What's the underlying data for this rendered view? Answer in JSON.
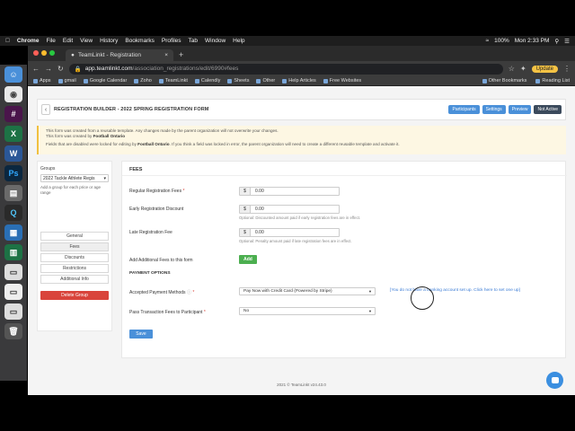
{
  "menubar": {
    "apple": "",
    "items": [
      "Chrome",
      "File",
      "Edit",
      "View",
      "History",
      "Bookmarks",
      "Profiles",
      "Tab",
      "Window",
      "Help"
    ],
    "battery": "100%",
    "clock": "Mon 2:33 PM"
  },
  "browser": {
    "tab_title": "TeamLinkt - Registration",
    "url_host": "app.teamlinkt.com",
    "url_path": "/association_registrations/edit/6990#fees",
    "update_label": "Update",
    "bookmarks": [
      "Apps",
      "gmail",
      "Google Calendar",
      "Zoho",
      "TeamLinkt",
      "Calendly",
      "Sheets",
      "Other",
      "Help Articles",
      "Free Websites"
    ],
    "bookmarks_right": [
      "Other Bookmarks",
      "Reading List"
    ]
  },
  "header": {
    "back_label": "‹",
    "title": "REGISTRATION BUILDER - 2022 SPRING REGISTRATION FORM",
    "buttons": [
      "Participants",
      "Settings",
      "Preview",
      "Not Active"
    ]
  },
  "notice": {
    "line1": "This form was created from a reusable template. Any changes made by the parent organization will not overwrite your changes.",
    "line2_prefix": "This form was created by ",
    "line2_org": "Football Ontario",
    "line3_prefix": "Fields that are disabled were locked for editing by ",
    "line3_org": "Football Ontario",
    "line3_suffix": ". If you think a field was locked in error, the parent organization will need to create a different reusable template and activate it."
  },
  "sidebar": {
    "groups_label": "Groups",
    "group_selected": "2022 Tackle Athlete Regis",
    "group_help": "Add a group for each price or age range",
    "nav": [
      "General",
      "Fees",
      "Discounts",
      "Restrictions",
      "Additional Info"
    ],
    "active": "Fees",
    "delete_label": "Delete Group"
  },
  "fees": {
    "heading": "FEES",
    "regular_label": "Regular Registration Fees",
    "required_mark": "*",
    "currency": "$",
    "regular_value": "0.00",
    "early_label": "Early Registration Discount",
    "early_value": "0.00",
    "early_help": "Optional: Discounted amount paid if early registration fees are in effect.",
    "late_label": "Late Registration Fee",
    "late_value": "0.00",
    "late_help": "Optional: Penalty amount paid if late registration fees are in effect.",
    "additional_label": "Add Additional Fees to this form",
    "add_label": "Add",
    "payment_heading": "PAYMENT OPTIONS",
    "accepted_label": "Accepted Payment Methods",
    "accepted_value": "Pay Now with Credit Card (Powered by Stripe)",
    "account_link": "[You do not have a banking account set up. Click here to set one up]",
    "pass_label": "Pass Transaction Fees to Participant",
    "pass_value": "No",
    "save_label": "Save"
  },
  "footer": "2021 © TeamLinkt v24.43.0",
  "colors": {
    "primary": "#4a90d9",
    "danger": "#d9443b",
    "success": "#4caf50",
    "notice_bg": "#fdf7e3"
  }
}
